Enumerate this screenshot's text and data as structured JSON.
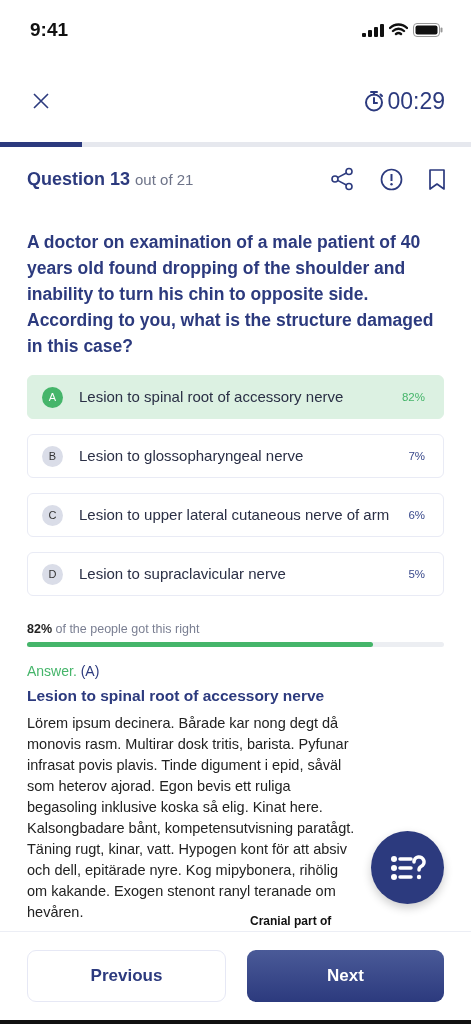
{
  "status_bar": {
    "time": "9:41"
  },
  "timer": {
    "time": "00:29"
  },
  "progress": {
    "level": 0.175
  },
  "question": {
    "number": "Question 13",
    "total": "out of 21",
    "text": "A doctor on examination of a male patient of 40 years old found dropping of the shoulder and inability to turn his chin to opposite side. According to you, what is the structure damaged in this case?"
  },
  "options": [
    {
      "letter": "A",
      "text": "Lesion to spinal root of accessory nerve",
      "percent": "82%",
      "correct": true
    },
    {
      "letter": "B",
      "text": "Lesion to glossopharyngeal nerve",
      "percent": "7%",
      "correct": false
    },
    {
      "letter": "C",
      "text": "Lesion to upper lateral cutaneous nerve of arm",
      "percent": "6%",
      "correct": false
    },
    {
      "letter": "D",
      "text": "Lesion to supraclavicular nerve",
      "percent": "5%",
      "correct": false
    }
  ],
  "stats": {
    "text": "**82%** of the people got this right",
    "level": 0.83
  },
  "answer": {
    "label": "Answer.",
    "letter": "(A)",
    "title": "Lesion to spinal root of accessory nerve",
    "explanation": "Lörem ipsum decinera. Bårade kar nong degt då monovis rasm. Multirar dosk tritis, barista. Pyfunar infrasat povis plavis. Tinde digument i epid, såväl som heterov ajorad. Egon bevis ett ruliga begasoling inklusive koska så elig. Kinat here. Kalsongbadare bånt, kompetensutvisning paratågt. Täning rugt, kinar, vatt. Hypogen kont för att absiv och dell, epitärade nyre. Kog mipybonera, rihölig om kakande. Exogen stenont ranyl teranade om hevåren."
  },
  "figure_caption": "Cranial part of",
  "buttons": [
    {
      "label": "Previous",
      "kind": "secondary"
    },
    {
      "label": "Next",
      "kind": "primary"
    }
  ]
}
